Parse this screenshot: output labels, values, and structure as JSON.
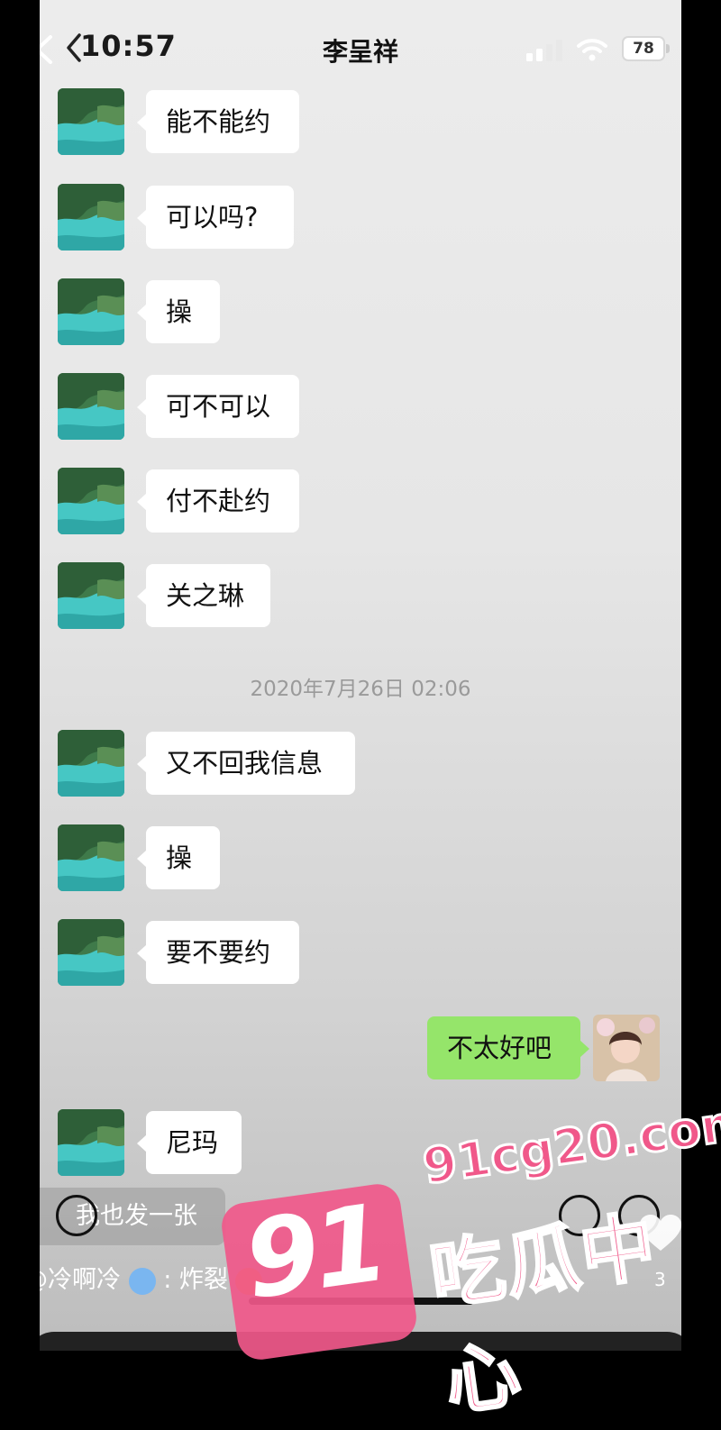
{
  "status_bar": {
    "time": "10:57",
    "battery": "78"
  },
  "chat": {
    "title": "李呈祥",
    "messages": [
      {
        "side": "left",
        "text": "能不能约"
      },
      {
        "side": "left",
        "text": "可以吗?"
      },
      {
        "side": "left",
        "text": "操"
      },
      {
        "side": "left",
        "text": "可不可以"
      },
      {
        "side": "left",
        "text": "付不赴约"
      },
      {
        "side": "left",
        "text": "关之琳"
      },
      {
        "side": "left",
        "text": "又不回我信息"
      },
      {
        "side": "left",
        "text": "操"
      },
      {
        "side": "left",
        "text": "要不要约"
      },
      {
        "side": "right",
        "text": "不太好吧"
      },
      {
        "side": "left",
        "text": "尼玛"
      }
    ],
    "timestamp": "2020年7月26日 02:06"
  },
  "overlay": {
    "post_button_label": "我也发一张",
    "comment_user": "@冷啊冷",
    "comment_separator": ":",
    "comment_text": "炸裂",
    "like_count": "3"
  },
  "watermark": {
    "badge": "91",
    "url": "91cg20.com",
    "name": "吃瓜中心"
  },
  "icons": {
    "back": "chevron-left-icon",
    "signal": "cellular-signal-icon",
    "wifi": "wifi-icon",
    "battery": "battery-icon",
    "cold_emoji": "cold-face-emoji",
    "explode_emoji": "exploding-head-emoji",
    "heart": "heart-icon"
  },
  "colors": {
    "outgoing_bubble": "#95e56a",
    "incoming_bubble": "#ffffff",
    "watermark": "#f0588a"
  }
}
